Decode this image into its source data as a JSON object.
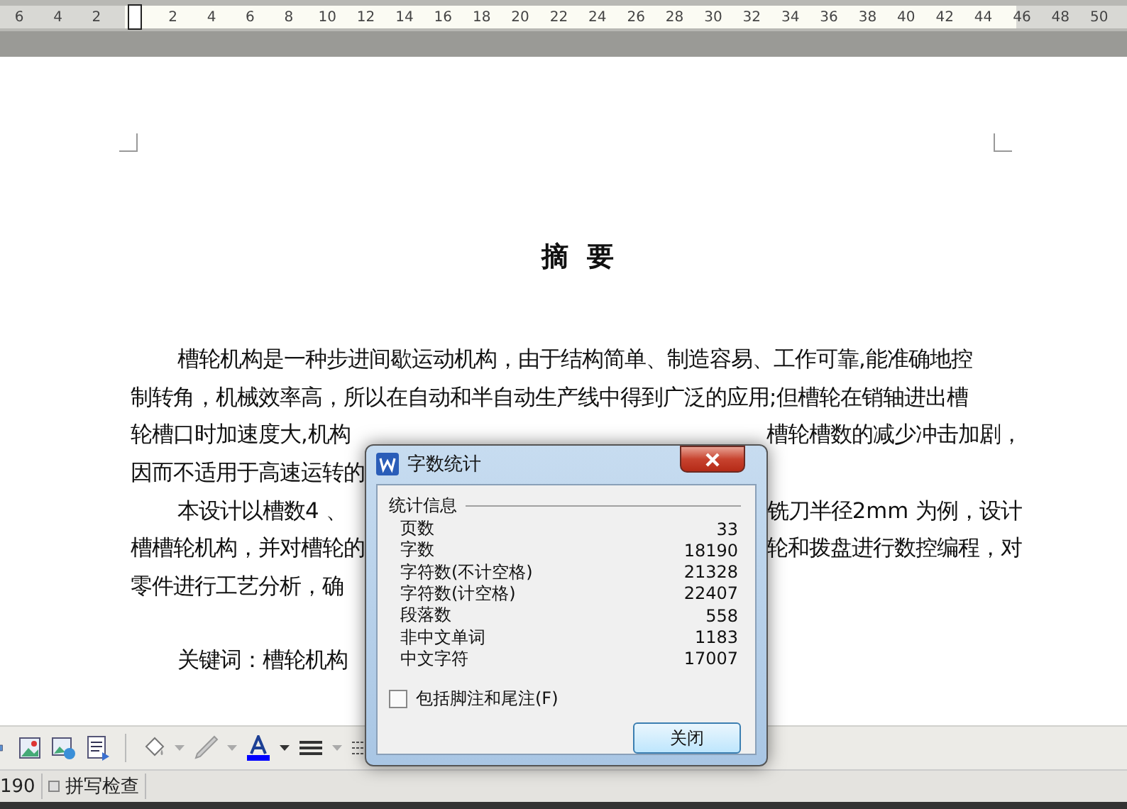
{
  "ruler": {
    "numbers": [
      "6",
      "4",
      "2",
      "2",
      "4",
      "6",
      "8",
      "10",
      "12",
      "14",
      "16",
      "18",
      "20",
      "22",
      "24",
      "26",
      "28",
      "30",
      "32",
      "34",
      "36",
      "38",
      "40",
      "42",
      "44",
      "46",
      "48",
      "50"
    ]
  },
  "document": {
    "title": "摘  要",
    "paragraphs": [
      {
        "lines": [
          [
            "槽轮机构是一种步进间歇运动机构，由于结构简单、制造容易、工作可靠,能准确地控"
          ],
          [
            "制转角，机械效率高，所以在自动和半自动生产线中得到广泛的应用;但槽轮在销轴进出槽"
          ],
          [
            "轮槽口时加速度大,机构",
            "槽轮槽数的减少冲击加剧，"
          ],
          [
            "因而不适用于高速运转的"
          ]
        ]
      },
      {
        "lines": [
          [
            "本设计以槽数4 、",
            "铣刀半径2mm 为例，设计"
          ],
          [
            "槽槽轮机构，并对槽轮的",
            "轮和拨盘进行数控编程，对"
          ],
          [
            "零件进行工艺分析，确"
          ]
        ]
      }
    ],
    "keywords": "关键词：槽轮机构"
  },
  "status_bar": {
    "count": "190",
    "spell_check": "拼写检查"
  },
  "dialog": {
    "title": "字数统计",
    "group": "统计信息",
    "stats": [
      {
        "label": "页数",
        "value": "33"
      },
      {
        "label": "字数",
        "value": "18190"
      },
      {
        "label": "字符数(不计空格)",
        "value": "21328"
      },
      {
        "label": "字符数(计空格)",
        "value": "22407"
      },
      {
        "label": "段落数",
        "value": "558"
      },
      {
        "label": "非中文单词",
        "value": "1183"
      },
      {
        "label": "中文字符",
        "value": "17007"
      }
    ],
    "checkbox": {
      "label": "包括脚注和尾注(F)",
      "checked": false
    },
    "button": "关闭"
  }
}
